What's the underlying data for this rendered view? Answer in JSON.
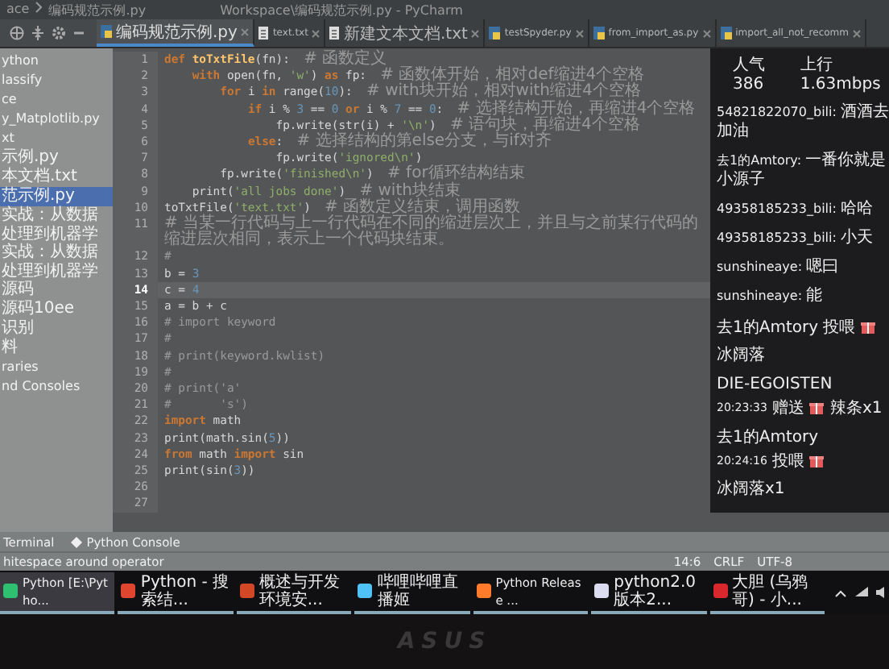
{
  "window": {
    "breadcrumb": [
      "ace",
      "编码规范示例.py"
    ],
    "title": "Workspace\\编码规范示例.py - PyCharm"
  },
  "tabs": [
    {
      "label": "编码规范示例.py",
      "kind": "py",
      "selected": true
    },
    {
      "label": "text.txt",
      "kind": "txt",
      "selected": false
    },
    {
      "label": "新建文本文档.txt",
      "kind": "txt",
      "selected": false
    },
    {
      "label": "testSpyder.py",
      "kind": "py",
      "selected": false
    },
    {
      "label": "from_import_as.py",
      "kind": "py",
      "selected": false
    },
    {
      "label": "import_all_not_recomm",
      "kind": "py",
      "selected": false
    }
  ],
  "project": {
    "items": [
      {
        "label": "ython",
        "selected": false
      },
      {
        "label": "lassify",
        "selected": false
      },
      {
        "label": "ce",
        "selected": false
      },
      {
        "label": "y_Matplotlib.py",
        "selected": false
      },
      {
        "label": "xt",
        "selected": false
      },
      {
        "label": "示例.py",
        "selected": false
      },
      {
        "label": "本文档.txt",
        "selected": false
      },
      {
        "label": "范示例.py",
        "selected": true
      },
      {
        "label": "实战：从数据处理到机器学",
        "selected": false
      },
      {
        "label": "实战：从数据处理到机器学",
        "selected": false
      },
      {
        "label": "源码",
        "selected": false
      },
      {
        "label": "源码10ee",
        "selected": false
      },
      {
        "label": "识别",
        "selected": false
      },
      {
        "label": "料",
        "selected": false
      },
      {
        "label": "raries",
        "selected": false
      },
      {
        "label": "nd Consoles",
        "selected": false
      }
    ]
  },
  "editor": {
    "lines": [
      {
        "number": "1",
        "current": false,
        "tokens": [
          {
            "kind": "kw",
            "t": "def "
          },
          {
            "kind": "fn",
            "t": "toTxtFile"
          },
          {
            "kind": "p",
            "t": "(fn):  "
          },
          {
            "kind": "cmt",
            "t": "# 函数定义"
          }
        ]
      },
      {
        "number": "2",
        "current": false,
        "tokens": [
          {
            "kind": "kw",
            "t": "    with "
          },
          {
            "kind": "p",
            "t": "open(fn, "
          },
          {
            "kind": "str",
            "t": "'w'"
          },
          {
            "kind": "p",
            "t": ") "
          },
          {
            "kind": "kw",
            "t": "as "
          },
          {
            "kind": "p",
            "t": "fp:  "
          },
          {
            "kind": "cmt",
            "t": "# 函数体开始，相对def缩进4个空格"
          }
        ]
      },
      {
        "number": "3",
        "current": false,
        "tokens": [
          {
            "kind": "kw",
            "t": "        for "
          },
          {
            "kind": "p",
            "t": "i "
          },
          {
            "kind": "kw",
            "t": "in "
          },
          {
            "kind": "p",
            "t": "range("
          },
          {
            "kind": "num",
            "t": "10"
          },
          {
            "kind": "p",
            "t": "):  "
          },
          {
            "kind": "cmt",
            "t": "# with块开始，相对with缩进4个空格"
          }
        ]
      },
      {
        "number": "4",
        "current": false,
        "tokens": [
          {
            "kind": "kw",
            "t": "            if "
          },
          {
            "kind": "p",
            "t": "i % "
          },
          {
            "kind": "num",
            "t": "3"
          },
          {
            "kind": "p",
            "t": " == "
          },
          {
            "kind": "num",
            "t": "0"
          },
          {
            "kind": "kw",
            "t": " or "
          },
          {
            "kind": "p",
            "t": "i % "
          },
          {
            "kind": "num",
            "t": "7"
          },
          {
            "kind": "p",
            "t": " == "
          },
          {
            "kind": "num",
            "t": "0"
          },
          {
            "kind": "p",
            "t": ":  "
          },
          {
            "kind": "cmt",
            "t": "# 选择结构开始，再缩进4个空格"
          }
        ]
      },
      {
        "number": "5",
        "current": false,
        "tokens": [
          {
            "kind": "p",
            "t": "                fp.write(str(i) + "
          },
          {
            "kind": "str",
            "t": "'\\n'"
          },
          {
            "kind": "p",
            "t": ")  "
          },
          {
            "kind": "cmt",
            "t": "# 语句块，再缩进4个空格"
          }
        ]
      },
      {
        "number": "6",
        "current": false,
        "tokens": [
          {
            "kind": "kw",
            "t": "            else"
          },
          {
            "kind": "p",
            "t": ":  "
          },
          {
            "kind": "cmt",
            "t": "# 选择结构的第else分支，与if对齐"
          }
        ]
      },
      {
        "number": "7",
        "current": false,
        "tokens": [
          {
            "kind": "p",
            "t": "                fp.write("
          },
          {
            "kind": "str",
            "t": "'ignored\\n'"
          },
          {
            "kind": "p",
            "t": ")"
          }
        ]
      },
      {
        "number": "8",
        "current": false,
        "tokens": [
          {
            "kind": "p",
            "t": "        fp.write("
          },
          {
            "kind": "str",
            "t": "'finished\\n'"
          },
          {
            "kind": "p",
            "t": ")  "
          },
          {
            "kind": "cmt",
            "t": "# for循环结构结束"
          }
        ]
      },
      {
        "number": "9",
        "current": false,
        "tokens": [
          {
            "kind": "p",
            "t": "    print("
          },
          {
            "kind": "str",
            "t": "'all jobs done'"
          },
          {
            "kind": "p",
            "t": ")  "
          },
          {
            "kind": "cmt",
            "t": "# with块结束"
          }
        ]
      },
      {
        "number": "10",
        "current": false,
        "tokens": [
          {
            "kind": "p",
            "t": "toTxtFile("
          },
          {
            "kind": "str",
            "t": "'text.txt'"
          },
          {
            "kind": "p",
            "t": ")  "
          },
          {
            "kind": "cmt",
            "t": "# 函数定义结束，调用函数"
          }
        ]
      },
      {
        "number": "11",
        "current": false,
        "tokens": [
          {
            "kind": "cmt",
            "t": "# 当某一行代码与上一行代码在不同的缩进层次上，并且与之前某行代码的缩进层次相同，表示上一个代码块结束。"
          }
        ]
      },
      {
        "number": "12",
        "current": false,
        "tokens": [
          {
            "kind": "cmt",
            "t": "#"
          }
        ]
      },
      {
        "number": "13",
        "current": false,
        "tokens": [
          {
            "kind": "p",
            "t": "b = "
          },
          {
            "kind": "num",
            "t": "3"
          }
        ]
      },
      {
        "number": "14",
        "current": true,
        "tokens": [
          {
            "kind": "p",
            "t": "c = "
          },
          {
            "kind": "num",
            "t": "4"
          }
        ]
      },
      {
        "number": "15",
        "current": false,
        "tokens": [
          {
            "kind": "p",
            "t": "a = b + c"
          }
        ]
      },
      {
        "number": "16",
        "current": false,
        "tokens": [
          {
            "kind": "cmt",
            "t": "# import keyword"
          }
        ]
      },
      {
        "number": "17",
        "current": false,
        "tokens": [
          {
            "kind": "cmt",
            "t": "#"
          }
        ]
      },
      {
        "number": "18",
        "current": false,
        "tokens": [
          {
            "kind": "cmt",
            "t": "# print(keyword.kwlist)"
          }
        ]
      },
      {
        "number": "19",
        "current": false,
        "tokens": [
          {
            "kind": "cmt",
            "t": "#"
          }
        ]
      },
      {
        "number": "20",
        "current": false,
        "tokens": [
          {
            "kind": "cmt",
            "t": "# print('a'"
          }
        ]
      },
      {
        "number": "21",
        "current": false,
        "tokens": [
          {
            "kind": "cmt",
            "t": "#       's')"
          }
        ]
      },
      {
        "number": "22",
        "current": false,
        "tokens": [
          {
            "kind": "kw",
            "t": "import "
          },
          {
            "kind": "p",
            "t": "math"
          }
        ]
      },
      {
        "number": "23",
        "current": false,
        "tokens": [
          {
            "kind": "p",
            "t": "print(math.sin("
          },
          {
            "kind": "num",
            "t": "5"
          },
          {
            "kind": "p",
            "t": "))"
          }
        ]
      },
      {
        "number": "24",
        "current": false,
        "tokens": [
          {
            "kind": "kw",
            "t": "from "
          },
          {
            "kind": "p",
            "t": "math "
          },
          {
            "kind": "kw",
            "t": "import "
          },
          {
            "kind": "p",
            "t": "sin"
          }
        ]
      },
      {
        "number": "25",
        "current": false,
        "tokens": [
          {
            "kind": "p",
            "t": "print(sin("
          },
          {
            "kind": "num",
            "t": "3"
          },
          {
            "kind": "p",
            "t": "))"
          }
        ]
      },
      {
        "number": "26",
        "current": false
      },
      {
        "number": "27",
        "current": false
      }
    ]
  },
  "chat": {
    "popularity": "人气 386",
    "upload": "上行 1.63mbps",
    "messages": [
      {
        "kind": "chat",
        "user": "54821822070_bili:",
        "text": "酒酒去加油"
      },
      {
        "kind": "chat",
        "user": "去1的Amtory:",
        "text": "一番你就是小源子"
      },
      {
        "kind": "chat",
        "user": "49358185233_bili:",
        "text": "哈哈"
      },
      {
        "kind": "chat",
        "user": "49358185233_bili:",
        "text": "小天"
      },
      {
        "kind": "chat",
        "user": "sunshineaye:",
        "text": "嗯曰"
      },
      {
        "kind": "chat",
        "user": "sunshineaye:",
        "text": "能"
      },
      {
        "kind": "gift",
        "user": "去1的Amtory",
        "action": "投喂",
        "gift": "冰阔落"
      },
      {
        "kind": "gift_card",
        "user": "DIE-EGOISTEN",
        "time": "20:23:33",
        "action": "赠送",
        "gift": "辣条x1"
      },
      {
        "kind": "gift_card",
        "user": "去1的Amtory",
        "time": "20:24:16",
        "action": "投喂",
        "gift": "冰阔落x1"
      }
    ]
  },
  "tool_windows": [
    {
      "label": "Terminal"
    },
    {
      "label": "Python Console"
    }
  ],
  "status_bar": {
    "message": "hitespace around operator",
    "position": "14:6",
    "line_separator": "CRLF",
    "encoding": "UTF-8"
  },
  "taskbar": {
    "items": [
      {
        "label": "Python [E:\\Pytho...",
        "color": "#2fbf71",
        "selected": true
      },
      {
        "label": "Python - 搜索结...",
        "color": "#e0452f",
        "selected": false
      },
      {
        "label": "概述与开发环境安...",
        "color": "#d24726",
        "selected": false
      },
      {
        "label": "哔哩哔哩直播姬",
        "color": "#4fc3f7",
        "selected": false
      },
      {
        "label": "Python Release ...",
        "color": "#ff7b2c",
        "selected": false
      },
      {
        "label": "python2.0版本2...",
        "color": "#dcdcf0",
        "selected": false
      },
      {
        "label": "大胆 (乌鸦哥) - 小...",
        "color": "#d9272e",
        "selected": false
      }
    ]
  },
  "bezel": {
    "logo": "ASUS"
  }
}
